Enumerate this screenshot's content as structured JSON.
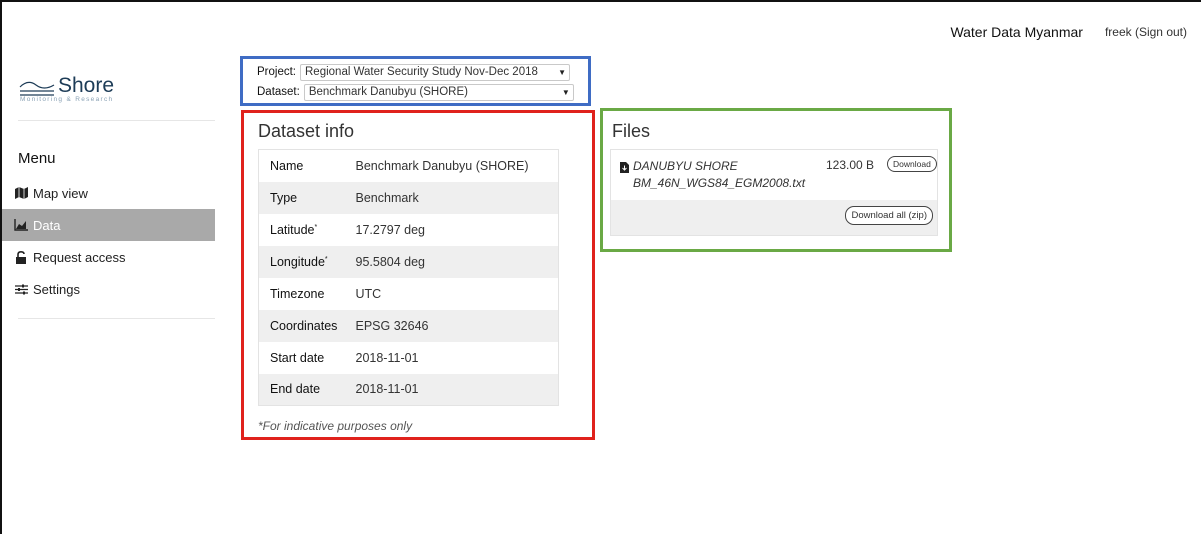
{
  "header": {
    "site_title": "Water Data Myanmar",
    "user_link": "freek (Sign out)"
  },
  "logo": {
    "name": "Shore",
    "tagline": "Monitoring & Research",
    "icon": "waves-icon"
  },
  "menu": {
    "title": "Menu",
    "items": [
      {
        "label": "Map view",
        "icon": "map-icon",
        "active": false
      },
      {
        "label": "Data",
        "icon": "area-chart-icon",
        "active": true
      },
      {
        "label": "Request access",
        "icon": "lock-icon",
        "active": false
      },
      {
        "label": "Settings",
        "icon": "sliders-icon",
        "active": false
      }
    ]
  },
  "selectors": {
    "project_label": "Project:",
    "project_value": "Regional Water Security Study Nov-Dec 2018",
    "dataset_label": "Dataset:",
    "dataset_value": "Benchmark Danubyu (SHORE)"
  },
  "dataset_info": {
    "title": "Dataset info",
    "rows": [
      {
        "key": "Name",
        "value": "Benchmark Danubyu (SHORE)"
      },
      {
        "key": "Type",
        "value": "Benchmark"
      },
      {
        "key": "Latitude",
        "sup": "*",
        "value": "17.2797 deg"
      },
      {
        "key": "Longitude",
        "sup": "*",
        "value": "95.5804 deg"
      },
      {
        "key": "Timezone",
        "value": "UTC"
      },
      {
        "key": "Coordinates",
        "value": "EPSG 32646"
      },
      {
        "key": "Start date",
        "value": "2018-11-01"
      },
      {
        "key": "End date",
        "value": "2018-11-01"
      }
    ],
    "footnote": "*For indicative purposes only"
  },
  "files": {
    "title": "Files",
    "items": [
      {
        "name": "DANUBYU SHORE BM_46N_WGS84_EGM2008.txt",
        "size": "123.00 B",
        "download_label": "Download",
        "icon": "file-icon"
      }
    ],
    "download_all_label": "Download all (zip)"
  },
  "colors": {
    "selector_outline": "#3f6cc4",
    "info_outline": "#e0221c",
    "files_outline": "#6aa945",
    "active_menu_bg": "#a9a9a9"
  }
}
